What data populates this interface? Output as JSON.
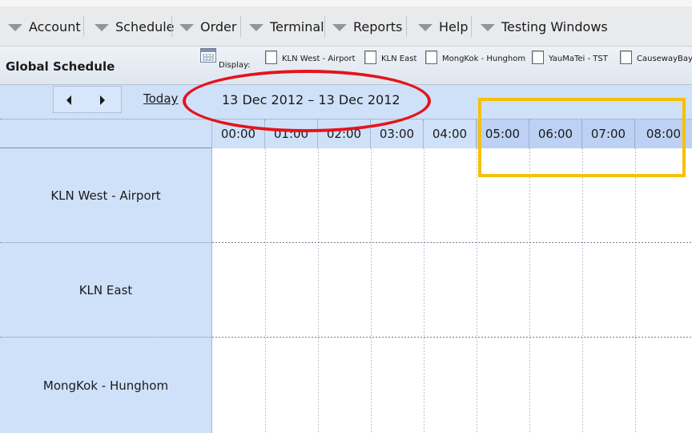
{
  "menu": {
    "items": [
      {
        "label": "Account"
      },
      {
        "label": "Schedule"
      },
      {
        "label": "Order"
      },
      {
        "label": "Terminal"
      },
      {
        "label": "Reports"
      },
      {
        "label": "Help"
      },
      {
        "label": "Testing Windows"
      }
    ]
  },
  "panel": {
    "title": "Global Schedule",
    "display_label": "Display:",
    "display_options": [
      {
        "label": "KLN West - Airport",
        "checked": false
      },
      {
        "label": "KLN East",
        "checked": false
      },
      {
        "label": "MongKok - Hunghom",
        "checked": false
      },
      {
        "label": "YauMaTei - TST",
        "checked": false
      },
      {
        "label": "CausewayBay",
        "checked": false
      }
    ]
  },
  "scheduler": {
    "today_label": "Today",
    "date_range": "13 Dec 2012 – 13 Dec 2012",
    "time_slots": [
      "00:00",
      "01:00",
      "02:00",
      "03:00",
      "04:00",
      "05:00",
      "06:00",
      "07:00",
      "08:00"
    ],
    "highlighted_slots": [
      "05:00",
      "06:00",
      "07:00",
      "08:00"
    ],
    "rows": [
      {
        "label": "KLN West - Airport"
      },
      {
        "label": "KLN East"
      },
      {
        "label": "MongKok - Hunghom"
      }
    ]
  },
  "icons": {
    "menu_arrow": "triangle-down-icon",
    "prev": "chevron-left-icon",
    "next": "chevron-right-icon",
    "display": "calendar-grid-icon"
  },
  "colors": {
    "annotation_circle": "#e4141b",
    "annotation_box": "#f6c006",
    "scheduler_bg": "#cfe1f9"
  }
}
